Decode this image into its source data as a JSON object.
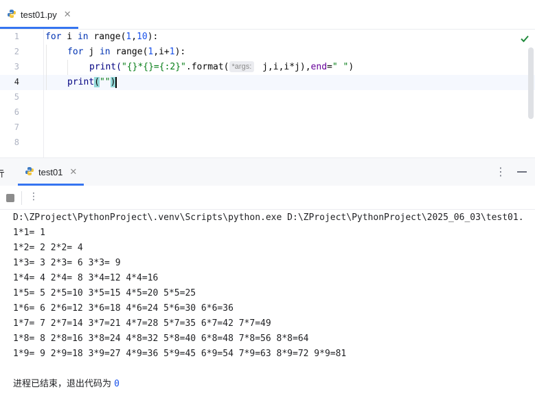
{
  "editor_tab": {
    "file_name": "test01.py",
    "close": "✕"
  },
  "editor": {
    "line_numbers": [
      "1",
      "2",
      "3",
      "4",
      "5",
      "6",
      "7",
      "8"
    ],
    "lines": {
      "l1": {
        "kw_for": "for",
        "var": " i ",
        "kw_in": "in",
        "fn_range": " range(",
        "n1": "1",
        "comma": ",",
        "n2": "10",
        "end": "):"
      },
      "l2": {
        "kw_for": "for",
        "var": " j ",
        "kw_in": "in",
        "fn_range": " range(",
        "n1": "1",
        "mid": ",i+",
        "n2": "1",
        "end": "):"
      },
      "l3": {
        "fn_print": "print(",
        "str": "\"{}*{}={:2}\"",
        "format": ".format(",
        "hint": "*args:",
        "args": " j,i,i*j),",
        "param": "end",
        "eq": "=",
        "str2": "\" \"",
        "close": ")"
      },
      "l4": {
        "fn_print": "print",
        "open": "(",
        "str": "\"\"",
        "close": ")"
      }
    }
  },
  "run_panel": {
    "title_partial": "亓",
    "tab_label": "test01",
    "tab_close": "✕",
    "menu": "⋮",
    "toolbar_more": "⋮",
    "console": {
      "command": "D:\\ZProject\\PythonProject\\.venv\\Scripts\\python.exe D:\\ZProject\\PythonProject\\2025_06_03\\test01.",
      "output": [
        "1*1= 1",
        "1*2= 2 2*2= 4",
        "1*3= 3 2*3= 6 3*3= 9",
        "1*4= 4 2*4= 8 3*4=12 4*4=16",
        "1*5= 5 2*5=10 3*5=15 4*5=20 5*5=25",
        "1*6= 6 2*6=12 3*6=18 4*6=24 5*6=30 6*6=36",
        "1*7= 7 2*7=14 3*7=21 4*7=28 5*7=35 6*7=42 7*7=49",
        "1*8= 8 2*8=16 3*8=24 4*8=32 5*8=40 6*8=48 7*8=56 8*8=64",
        "1*9= 9 2*9=18 3*9=27 4*9=36 5*9=45 6*9=54 7*9=63 8*9=72 9*9=81"
      ],
      "exit_text": "进程已结束，退出代码为 ",
      "exit_code": "0"
    }
  },
  "colors": {
    "accent": "#3574f0",
    "keyword": "#0033b3",
    "string": "#067d17",
    "number": "#1750eb",
    "check": "#208a3c"
  }
}
